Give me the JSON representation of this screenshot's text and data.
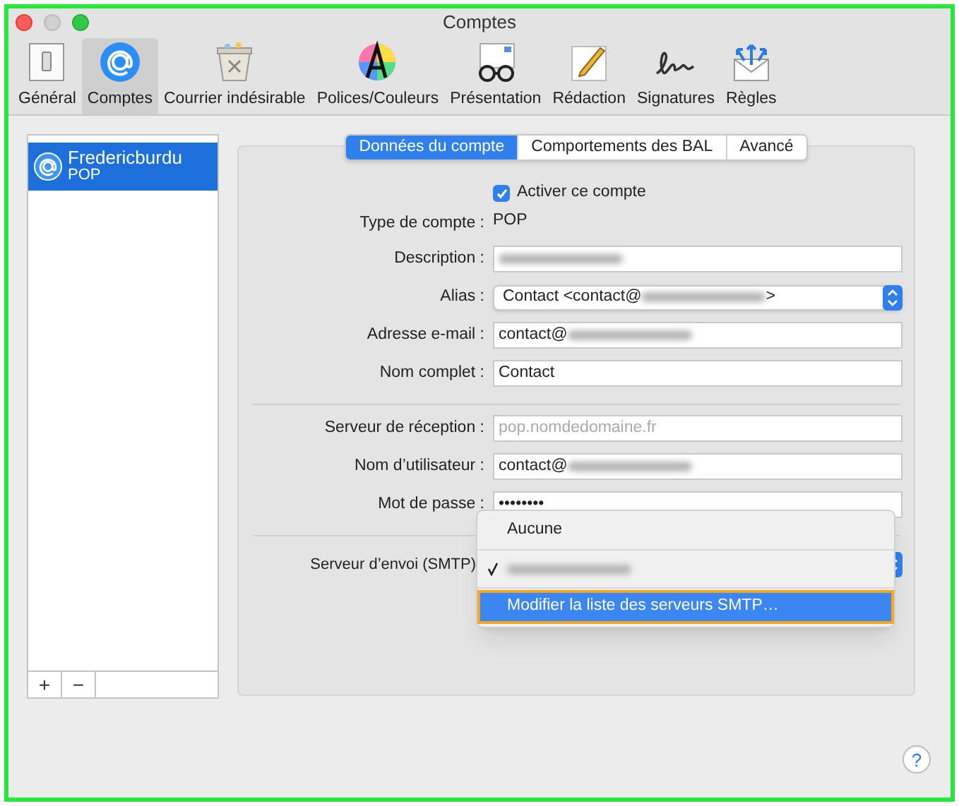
{
  "window": {
    "title": "Comptes"
  },
  "toolbar": [
    {
      "label": "Général",
      "selected": false
    },
    {
      "label": "Comptes",
      "selected": true
    },
    {
      "label": "Courrier indésirable",
      "selected": false
    },
    {
      "label": "Polices/Couleurs",
      "selected": false
    },
    {
      "label": "Présentation",
      "selected": false
    },
    {
      "label": "Rédaction",
      "selected": false
    },
    {
      "label": "Signatures",
      "selected": false
    },
    {
      "label": "Règles",
      "selected": false
    }
  ],
  "accounts": [
    {
      "name": "Fredericburdu",
      "type": "POP",
      "selected": true
    }
  ],
  "list_buttons": [
    "+",
    "−"
  ],
  "tabs": [
    {
      "label": "Données du compte",
      "selected": true
    },
    {
      "label": "Comportements des BAL",
      "selected": false
    },
    {
      "label": "Avancé",
      "selected": false
    }
  ],
  "enable_account": {
    "label": "Activer ce compte",
    "checked": true
  },
  "account_type": {
    "label": "Type de compte :",
    "value": "POP"
  },
  "fields": [
    {
      "kind": "text",
      "label": "Description :",
      "redacted": true
    },
    {
      "kind": "popup",
      "label": "Alias :",
      "value": "Contact <contact@",
      "value_end": ">",
      "redacted": true
    },
    {
      "kind": "text",
      "label": "Adresse e-mail :",
      "value": "contact@",
      "redacted": true
    },
    {
      "kind": "text",
      "label": "Nom complet :",
      "value": "Contact",
      "redacted": false
    }
  ],
  "server_fields": [
    {
      "label": "Serveur de réception :",
      "placeholder": "pop.nomdedomaine.fr",
      "redacted": false
    },
    {
      "label": "Nom d’utilisateur :",
      "value": "contact@",
      "redacted": true
    },
    {
      "label": "Mot de passe :",
      "value": "••••••••",
      "redacted": false
    }
  ],
  "smtp": {
    "label": "Serveur d’envoi (SMTP)",
    "menu": [
      {
        "label": "Aucune",
        "redacted": false,
        "checked": false,
        "selected": false
      },
      {
        "redacted": true,
        "checked": true,
        "selected": false
      },
      {
        "label": "Modifier la liste des serveurs SMTP…",
        "redacted": false,
        "checked": false,
        "selected": true
      }
    ]
  },
  "help_button": "?"
}
